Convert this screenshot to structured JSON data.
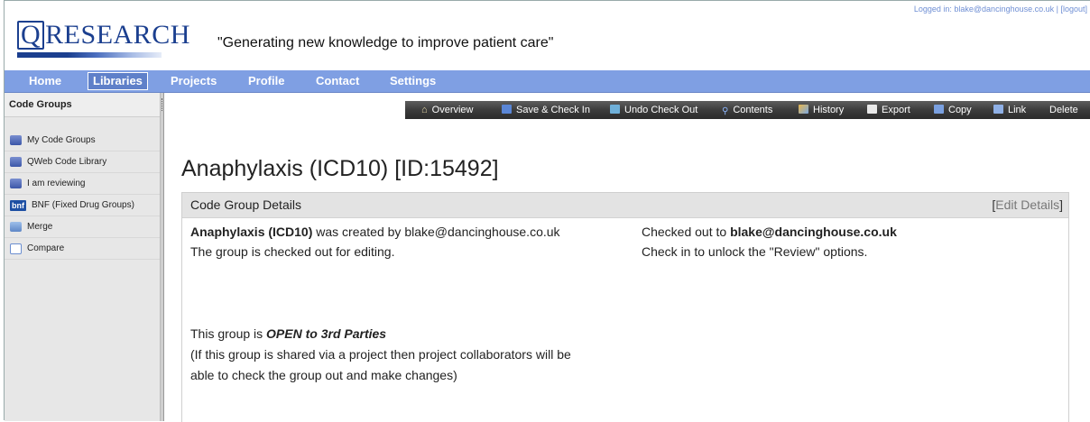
{
  "header": {
    "logo_text": "RESEARCH",
    "logo_q": "Q",
    "tagline": "\"Generating new knowledge to improve patient care\"",
    "logged_in_label": "Logged in: blake@dancinghouse.co.uk",
    "logout_label": "[logout]"
  },
  "nav": {
    "items": [
      "Home",
      "Libraries",
      "Projects",
      "Profile",
      "Contact",
      "Settings"
    ],
    "active": "Libraries"
  },
  "sidebar": {
    "title": "Code Groups",
    "items": [
      {
        "label": "My Code Groups",
        "icon": "database-icon"
      },
      {
        "label": "QWeb Code Library",
        "icon": "database-icon"
      },
      {
        "label": "I am reviewing",
        "icon": "database-icon"
      },
      {
        "label": "BNF (Fixed Drug Groups)",
        "icon": "bnf-icon",
        "icon_text": "bnf"
      },
      {
        "label": "Merge",
        "icon": "merge-icon"
      },
      {
        "label": "Compare",
        "icon": "compare-icon"
      }
    ]
  },
  "toolbar": {
    "items": [
      {
        "label": "Overview",
        "icon": "home-icon"
      },
      {
        "label": "Save & Check In",
        "icon": "save-icon"
      },
      {
        "label": "Undo Check Out",
        "icon": "undo-icon"
      },
      {
        "label": "Contents",
        "icon": "search-icon"
      },
      {
        "label": "History",
        "icon": "history-icon"
      },
      {
        "label": "Export",
        "icon": "export-icon"
      },
      {
        "label": "Copy",
        "icon": "copy-icon"
      },
      {
        "label": "Link",
        "icon": "link-icon"
      },
      {
        "label": "Delete",
        "icon": ""
      }
    ]
  },
  "main": {
    "title": "Anaphylaxis (ICD10) [ID:15492]",
    "panel": {
      "heading": "Code Group Details",
      "edit_bracket_open": "[",
      "edit_label": "Edit Details",
      "edit_bracket_close": "]",
      "group_name": "Anaphylaxis (ICD10)",
      "created_by_text": " was created by blake@dancinghouse.co.uk",
      "checked_out_status": "The group is checked out for editing.",
      "checked_out_to_label": "Checked out to ",
      "checked_out_to_user": "blake@dancinghouse.co.uk",
      "check_in_note": "Check in to unlock the \"Review\" options.",
      "open_prefix": "This group is ",
      "open_status": "OPEN to 3rd Parties",
      "share_note_1": "(If this group is shared via a project then project collaborators will be",
      "share_note_2": "able to check the group out and make changes)"
    }
  }
}
